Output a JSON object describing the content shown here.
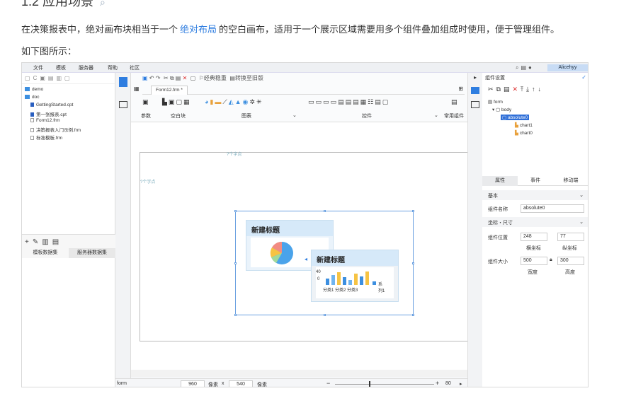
{
  "doc": {
    "heading": "1.2 应用场景",
    "heading_anchor": "⌕",
    "para_before": "在决策报表中，绝对画布块相当于一个",
    "para_link": "绝对布局",
    "para_after": "的空白画布，适用于一个展示区域需要用多个组件叠加组成时使用，便于管理组件。",
    "caption": "如下图所示："
  },
  "app": {
    "menu": [
      "文件",
      "模板",
      "服务器",
      "帮助",
      "社区"
    ],
    "user": "Alicehyy",
    "left_tree": [
      {
        "label": "demo",
        "type": "folder"
      },
      {
        "label": "doc",
        "type": "folder"
      },
      {
        "label": "GettingStarted.cpt",
        "type": "cpt"
      },
      {
        "label": "第一张报表.cpt",
        "type": "cpt"
      },
      {
        "label": "Form12.frm",
        "type": "frm"
      },
      {
        "label": "决策报表入门示例.frm",
        "type": "frm"
      },
      {
        "label": "标准模板.frm",
        "type": "frm"
      }
    ],
    "left_tabs": [
      "模板数据集",
      "服务器数据集"
    ],
    "toolbar": {
      "chk1": "经典稳重",
      "chk2": "转换至旧版"
    },
    "file_tab": "Form12.frm",
    "file_tab_mark": "*",
    "ribbon_groups": {
      "params": "参数",
      "blank": "空白块",
      "chart": "图表",
      "widget": "控件",
      "common": "常用组件"
    },
    "canvas": {
      "label_top": "?个字点",
      "label_left": "?个字点",
      "chart1_title": "新建标题",
      "chart2_title": "新建标题",
      "chart2_axis_top": "40",
      "chart2_axis_bottom": "0",
      "chart2_categories": "分类1 分类2 分类3",
      "chart2_legend": "系列1",
      "bar_values": [
        0.45,
        0.7,
        0.9,
        0.55,
        0.35,
        0.8,
        0.6,
        0.95
      ]
    },
    "status": {
      "name": "form",
      "width": "960",
      "unit1": "像素",
      "x": "x",
      "height": "540",
      "unit2": "像素",
      "minus": "−",
      "plus": "+",
      "zoom": "80"
    },
    "right": {
      "title": "组件设置",
      "tree": [
        "form",
        "body",
        "absolute0",
        "chart1",
        "chart0"
      ],
      "tabs": [
        "属性",
        "事件",
        "移动端"
      ],
      "sec_basic": "基本",
      "name_label": "组件名称",
      "name_value": "absolute0",
      "sec_coord": "坐标・尺寸",
      "pos_label": "组件位置",
      "pos_x": "248",
      "pos_y": "77",
      "hx_label": "横坐标",
      "vy_label": "纵坐标",
      "size_label": "组件大小",
      "size_w": "500",
      "size_h": "300",
      "w_label": "宽度",
      "h_label": "高度"
    }
  }
}
